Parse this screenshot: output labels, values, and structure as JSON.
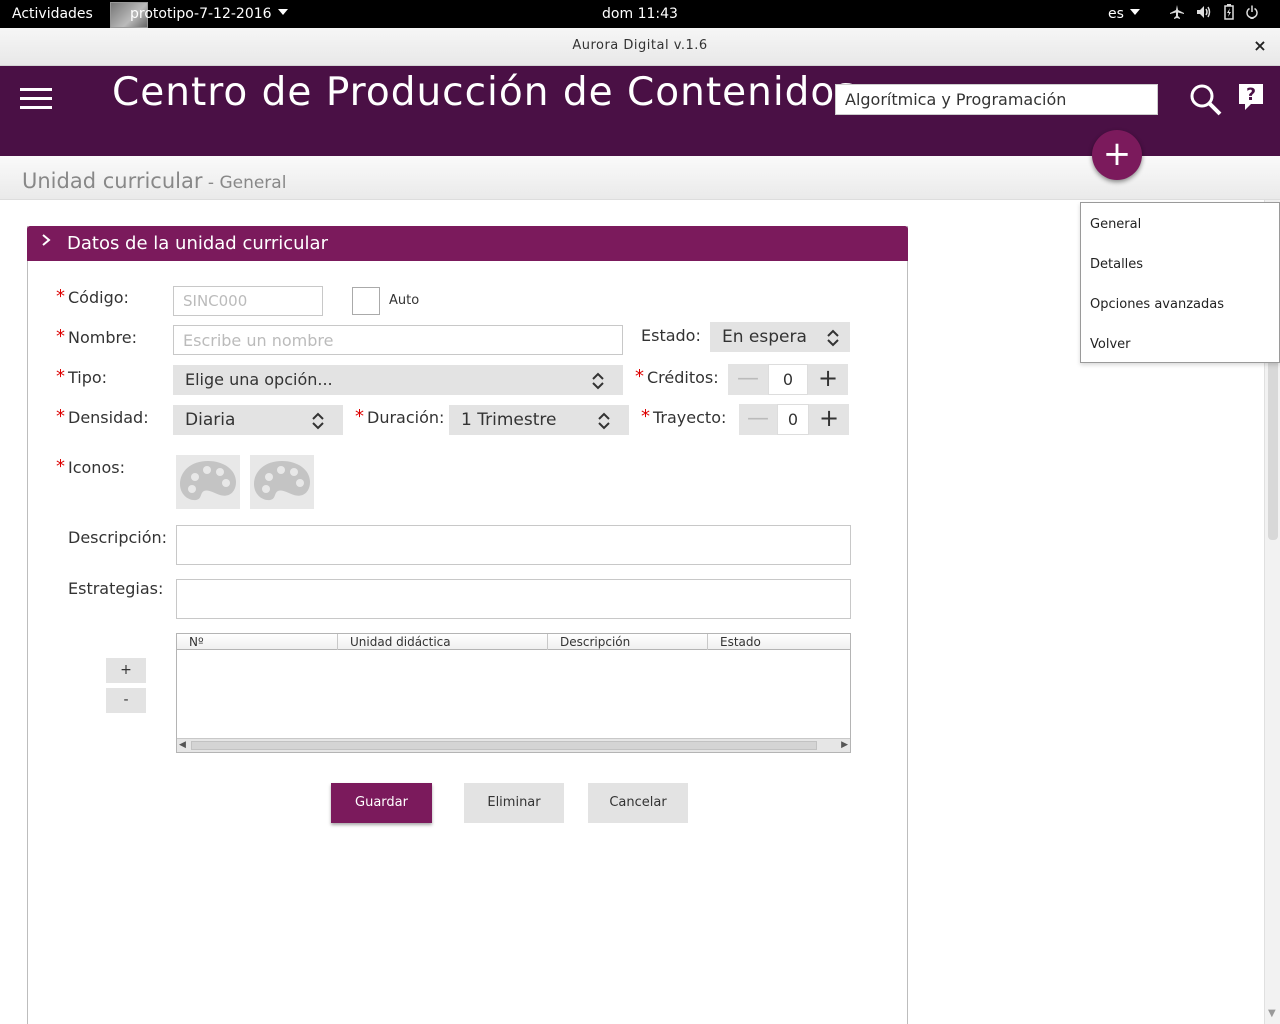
{
  "topbar": {
    "activities": "Actividades",
    "app_menu": "prototipo-7-12-2016",
    "clock": "dom 11:43",
    "language": "es"
  },
  "window": {
    "title": "Aurora Digital v.1.6",
    "close": "×"
  },
  "header": {
    "title": "Centro de Producción de Contenidos",
    "search_value": "Algorítmica y Programación",
    "fab_symbol": "+"
  },
  "subheader": {
    "title": "Unidad curricular",
    "section": " - General"
  },
  "side_menu": {
    "items": [
      "General",
      "Detalles",
      "Opciones avanzadas",
      "Volver"
    ]
  },
  "form": {
    "panel_title": "Datos de la unidad curricular",
    "codigo": {
      "label": "Código:",
      "placeholder": "SINC000",
      "auto_label": "Auto"
    },
    "nombre": {
      "label": "Nombre:",
      "placeholder": "Escribe un nombre"
    },
    "estado": {
      "label": "Estado:",
      "value": "En espera"
    },
    "tipo": {
      "label": "Tipo:",
      "value": "Elige una opción..."
    },
    "creditos": {
      "label": "Créditos:",
      "value": "0"
    },
    "densidad": {
      "label": "Densidad:",
      "value": "Diaria"
    },
    "duracion": {
      "label": "Duración:",
      "value": "1 Trimestre"
    },
    "trayecto": {
      "label": "Trayecto:",
      "value": "0"
    },
    "iconos": {
      "label": "Iconos:"
    },
    "descripcion": {
      "label": "Descripción:",
      "value": ""
    },
    "estrategias": {
      "label": "Estrategias:",
      "value": ""
    },
    "stepper_minus": "—",
    "stepper_plus": "+",
    "required_mark": "*"
  },
  "table": {
    "columns": [
      "Nº",
      "Unidad didáctica",
      "Descripción",
      "Estado"
    ],
    "rows": [],
    "add_row": "+",
    "remove_row": "-"
  },
  "actions": {
    "save": "Guardar",
    "delete": "Eliminar",
    "cancel": "Cancelar"
  },
  "colors": {
    "header_bg": "#4a1045",
    "accent": "#7b1a5c",
    "required": "#dd0000"
  },
  "icons": [
    "airplane-icon",
    "volume-icon",
    "battery-icon",
    "power-icon",
    "search-icon",
    "help-icon",
    "palette-icon"
  ]
}
